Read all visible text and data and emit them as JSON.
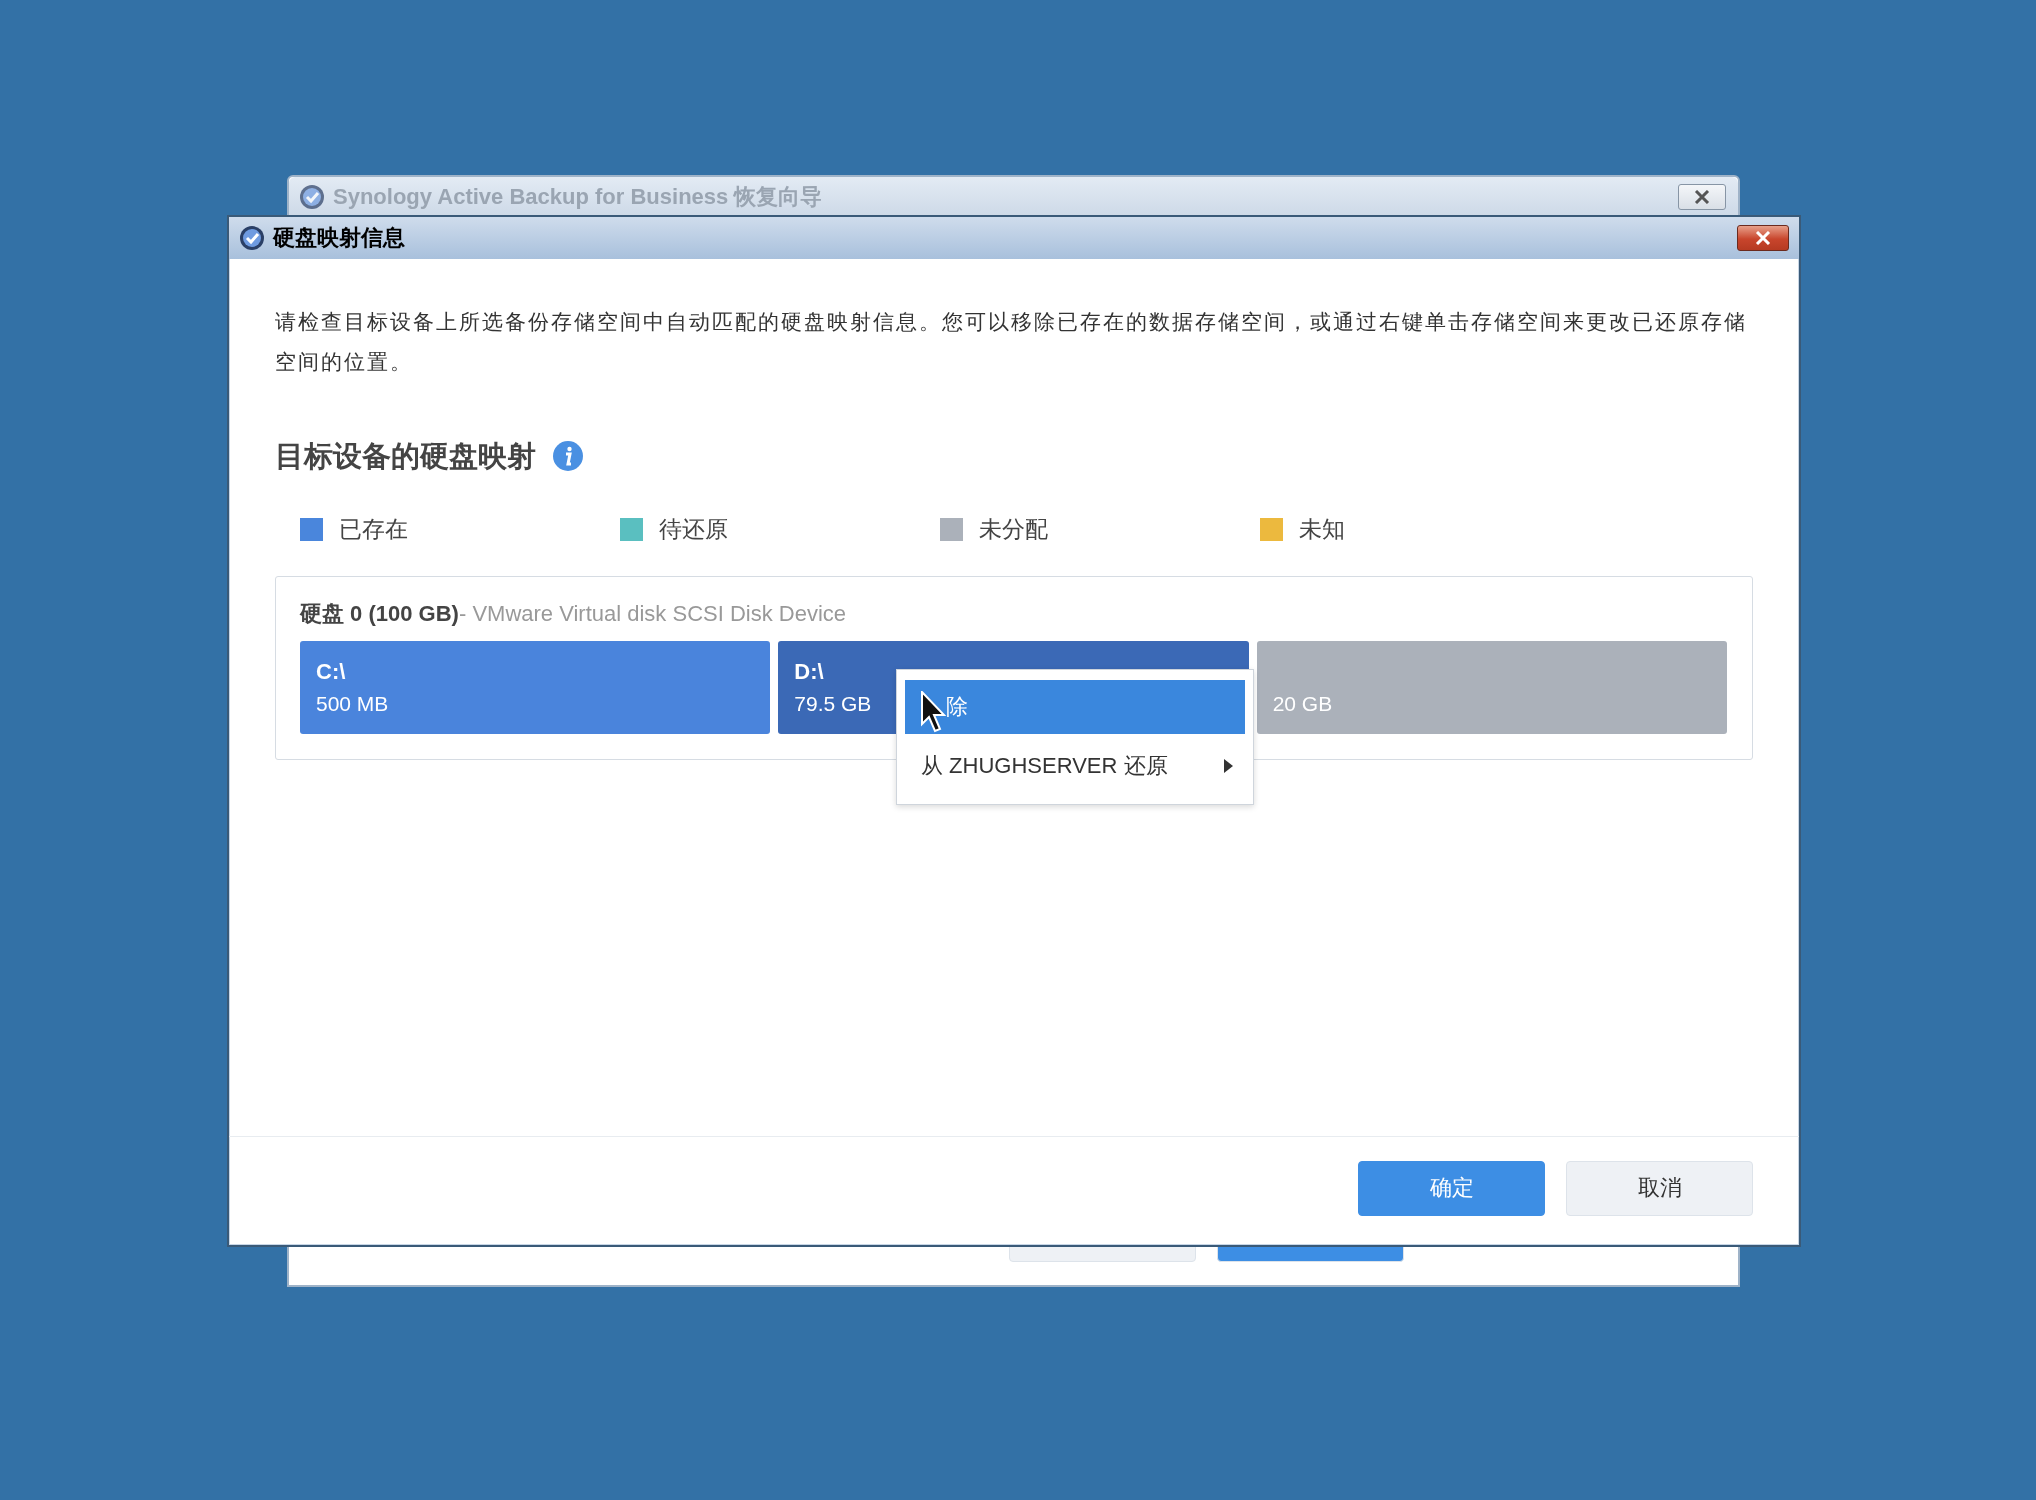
{
  "back_window": {
    "title": "Synology Active Backup for Business 恢复向导",
    "buttons": [
      {
        "kind": "secondary"
      },
      {
        "kind": "primary"
      }
    ]
  },
  "dialog": {
    "title": "硬盘映射信息",
    "description": "请检查目标设备上所选备份存储空间中自动匹配的硬盘映射信息。您可以移除已存在的数据存储空间，或通过右键单击存储空间来更改已还原存储空间的位置。",
    "section_title": "目标设备的硬盘映射",
    "legend": [
      {
        "label": "已存在",
        "color": "#4a86dc"
      },
      {
        "label": "待还原",
        "color": "#5abfc0"
      },
      {
        "label": "未分配",
        "color": "#abb1ba"
      },
      {
        "label": "未知",
        "color": "#ecb93e"
      }
    ],
    "disk": {
      "name": "硬盘 0 (100 GB)",
      "device": "- VMware Virtual disk SCSI Disk Device",
      "partitions": [
        {
          "kind": "existing",
          "label": "C:\\",
          "size": "500 MB",
          "selected": false
        },
        {
          "kind": "existing",
          "label": "D:\\",
          "size": "79.5 GB",
          "selected": true
        },
        {
          "kind": "unallocated",
          "size": "20 GB",
          "selected": false
        }
      ]
    },
    "context_menu": [
      {
        "label": "除",
        "selected": true,
        "submenu": false
      },
      {
        "label": "从 ZHUGHSERVER 还原",
        "selected": false,
        "submenu": true
      }
    ],
    "buttons": [
      {
        "label": "确定",
        "kind": "primary"
      },
      {
        "label": "取消",
        "kind": "secondary"
      }
    ]
  }
}
